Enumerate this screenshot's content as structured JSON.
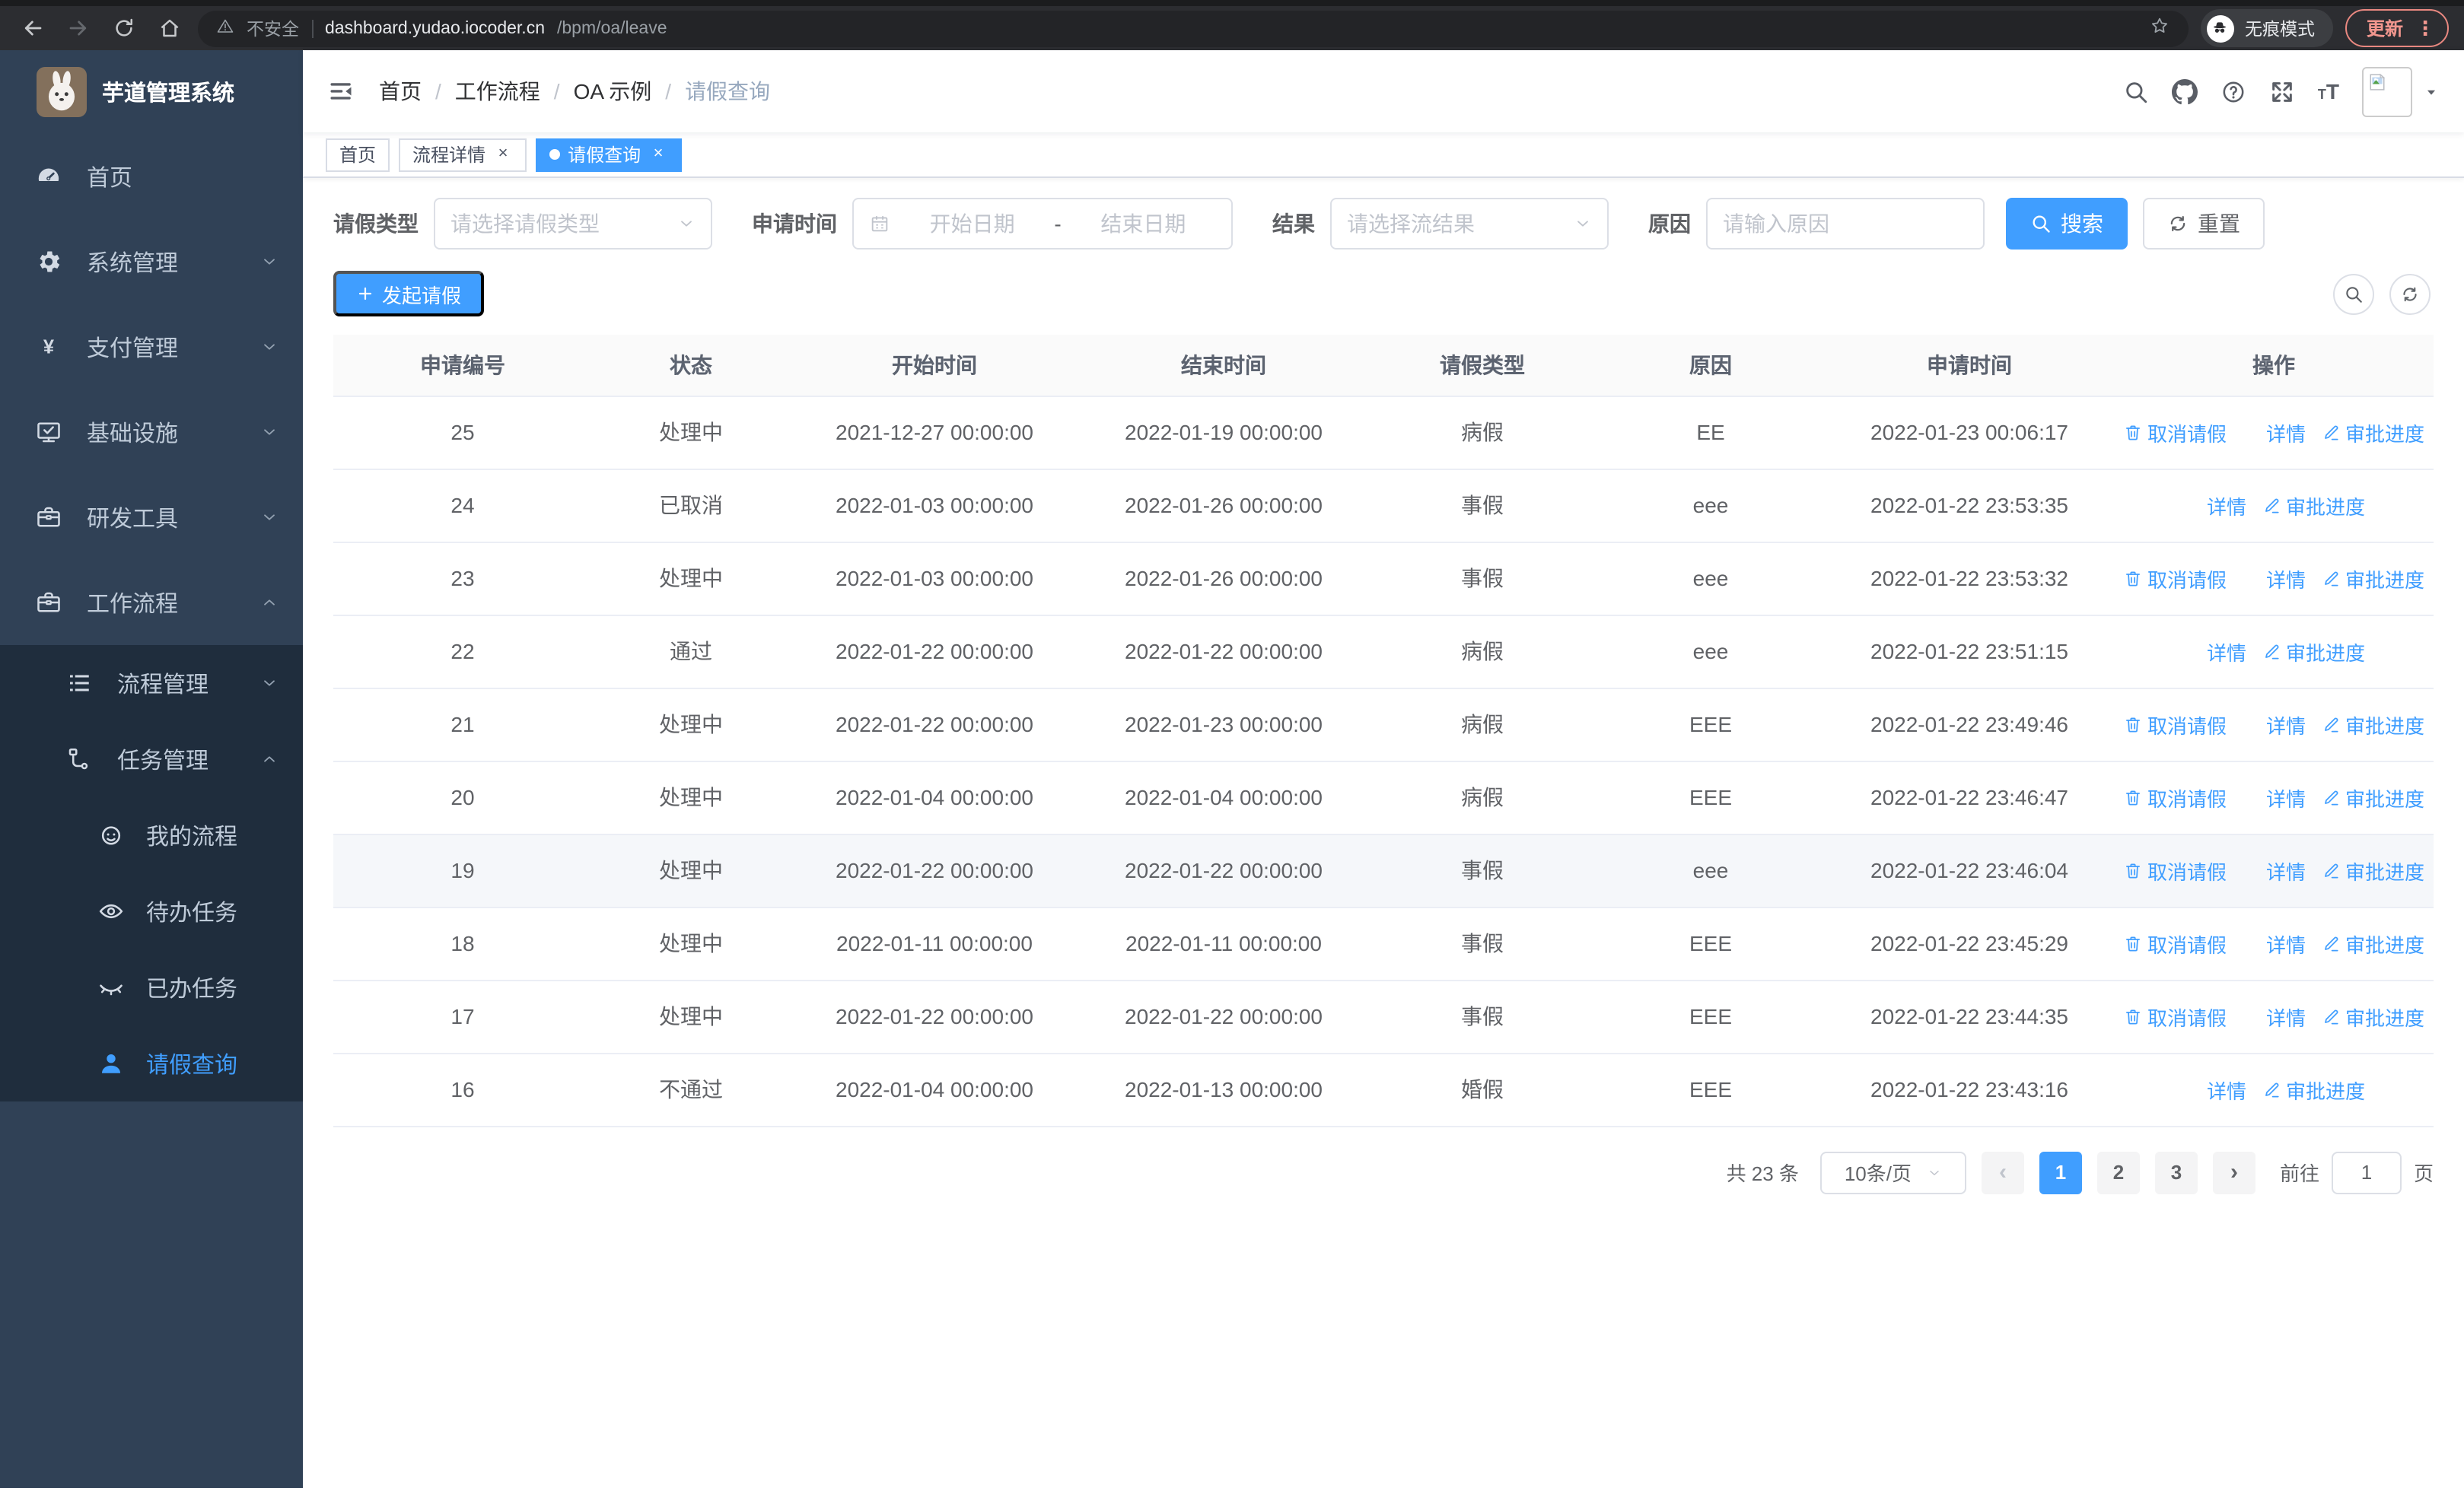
{
  "colors": {
    "accent": "#409eff",
    "sidebar_bg": "#304156",
    "submenu_bg": "#1f2d3d",
    "sidebar_text": "#bfcbd9",
    "update_badge": "#f1968e",
    "table_row_highlight": "#f5f7fa"
  },
  "browser": {
    "security_label": "不安全",
    "url_host": "dashboard.yudao.iocoder.cn",
    "url_path": "/bpm/oa/leave",
    "incognito_label": "无痕模式",
    "update_label": "更新",
    "icons": [
      "back-arrow-icon",
      "forward-arrow-icon",
      "reload-icon",
      "home-icon",
      "warning-icon",
      "bookmark-star-icon",
      "incognito-icon",
      "kebab-menu-icon"
    ]
  },
  "sidebar": {
    "app_title": "芋道管理系统",
    "menu": [
      {
        "label": "首页",
        "icon": "dashboard-icon"
      },
      {
        "label": "系统管理",
        "icon": "gear-icon",
        "chevron": "down"
      },
      {
        "label": "支付管理",
        "icon": "yen-icon",
        "chevron": "down"
      },
      {
        "label": "基础设施",
        "icon": "monitor-icon",
        "chevron": "down"
      },
      {
        "label": "研发工具",
        "icon": "toolbox-icon",
        "chevron": "down"
      },
      {
        "label": "工作流程",
        "icon": "briefcase-icon",
        "chevron": "up"
      },
      {
        "label": "流程管理",
        "icon": "list-icon",
        "chevron": "down"
      },
      {
        "label": "任务管理",
        "icon": "tree-icon",
        "chevron": "up"
      },
      {
        "label": "我的流程",
        "icon": "face-icon"
      },
      {
        "label": "待办任务",
        "icon": "eye-icon"
      },
      {
        "label": "已办任务",
        "icon": "eye-closed-icon"
      },
      {
        "label": "请假查询",
        "icon": "user-icon",
        "active": true
      }
    ]
  },
  "header": {
    "breadcrumb": [
      "首页",
      "工作流程",
      "OA 示例",
      "请假查询"
    ],
    "icons": [
      "search-icon",
      "github-icon",
      "help-icon",
      "fullscreen-icon",
      "font-size-icon",
      "avatar-broken-image-icon",
      "caret-down-icon"
    ]
  },
  "tabs": [
    {
      "label": "首页",
      "closable": false,
      "active": false
    },
    {
      "label": "流程详情",
      "closable": true,
      "active": false
    },
    {
      "label": "请假查询",
      "closable": true,
      "active": true
    }
  ],
  "filters": {
    "leave_type": {
      "label": "请假类型",
      "placeholder": "请选择请假类型"
    },
    "apply_time": {
      "label": "申请时间",
      "start_placeholder": "开始日期",
      "separator": "-",
      "end_placeholder": "结束日期"
    },
    "result": {
      "label": "结果",
      "placeholder": "请选择流结果"
    },
    "reason": {
      "label": "原因",
      "placeholder": "请输入原因"
    },
    "search_label": "搜索",
    "reset_label": "重置"
  },
  "toolbar": {
    "create_label": "发起请假"
  },
  "table": {
    "headers": [
      "申请编号",
      "状态",
      "开始时间",
      "结束时间",
      "请假类型",
      "原因",
      "申请时间",
      "操作"
    ],
    "action_labels": {
      "cancel": "取消请假",
      "detail": "详情",
      "progress": "审批进度"
    },
    "rows": [
      {
        "id": "25",
        "status": "处理中",
        "start": "2021-12-27 00:00:00",
        "end": "2022-01-19 00:00:00",
        "type": "病假",
        "reason": "EE",
        "applied": "2022-01-23 00:06:17",
        "actions": [
          "cancel",
          "detail",
          "progress"
        ]
      },
      {
        "id": "24",
        "status": "已取消",
        "start": "2022-01-03 00:00:00",
        "end": "2022-01-26 00:00:00",
        "type": "事假",
        "reason": "eee",
        "applied": "2022-01-22 23:53:35",
        "actions": [
          "detail",
          "progress"
        ]
      },
      {
        "id": "23",
        "status": "处理中",
        "start": "2022-01-03 00:00:00",
        "end": "2022-01-26 00:00:00",
        "type": "事假",
        "reason": "eee",
        "applied": "2022-01-22 23:53:32",
        "actions": [
          "cancel",
          "detail",
          "progress"
        ]
      },
      {
        "id": "22",
        "status": "通过",
        "start": "2022-01-22 00:00:00",
        "end": "2022-01-22 00:00:00",
        "type": "病假",
        "reason": "eee",
        "applied": "2022-01-22 23:51:15",
        "actions": [
          "detail",
          "progress"
        ]
      },
      {
        "id": "21",
        "status": "处理中",
        "start": "2022-01-22 00:00:00",
        "end": "2022-01-23 00:00:00",
        "type": "病假",
        "reason": "EEE",
        "applied": "2022-01-22 23:49:46",
        "actions": [
          "cancel",
          "detail",
          "progress"
        ]
      },
      {
        "id": "20",
        "status": "处理中",
        "start": "2022-01-04 00:00:00",
        "end": "2022-01-04 00:00:00",
        "type": "病假",
        "reason": "EEE",
        "applied": "2022-01-22 23:46:47",
        "actions": [
          "cancel",
          "detail",
          "progress"
        ]
      },
      {
        "id": "19",
        "status": "处理中",
        "start": "2022-01-22 00:00:00",
        "end": "2022-01-22 00:00:00",
        "type": "事假",
        "reason": "eee",
        "applied": "2022-01-22 23:46:04",
        "actions": [
          "cancel",
          "detail",
          "progress"
        ],
        "highlighted": true
      },
      {
        "id": "18",
        "status": "处理中",
        "start": "2022-01-11 00:00:00",
        "end": "2022-01-11 00:00:00",
        "type": "事假",
        "reason": "EEE",
        "applied": "2022-01-22 23:45:29",
        "actions": [
          "cancel",
          "detail",
          "progress"
        ]
      },
      {
        "id": "17",
        "status": "处理中",
        "start": "2022-01-22 00:00:00",
        "end": "2022-01-22 00:00:00",
        "type": "事假",
        "reason": "EEE",
        "applied": "2022-01-22 23:44:35",
        "actions": [
          "cancel",
          "detail",
          "progress"
        ]
      },
      {
        "id": "16",
        "status": "不通过",
        "start": "2022-01-04 00:00:00",
        "end": "2022-01-13 00:00:00",
        "type": "婚假",
        "reason": "EEE",
        "applied": "2022-01-22 23:43:16",
        "actions": [
          "detail",
          "progress"
        ]
      }
    ]
  },
  "pagination": {
    "total_label": "共 23 条",
    "page_size_label": "10条/页",
    "pages": [
      "1",
      "2",
      "3"
    ],
    "active_page": "1",
    "jump_label": "前往",
    "jump_value": "1",
    "jump_unit": "页"
  }
}
